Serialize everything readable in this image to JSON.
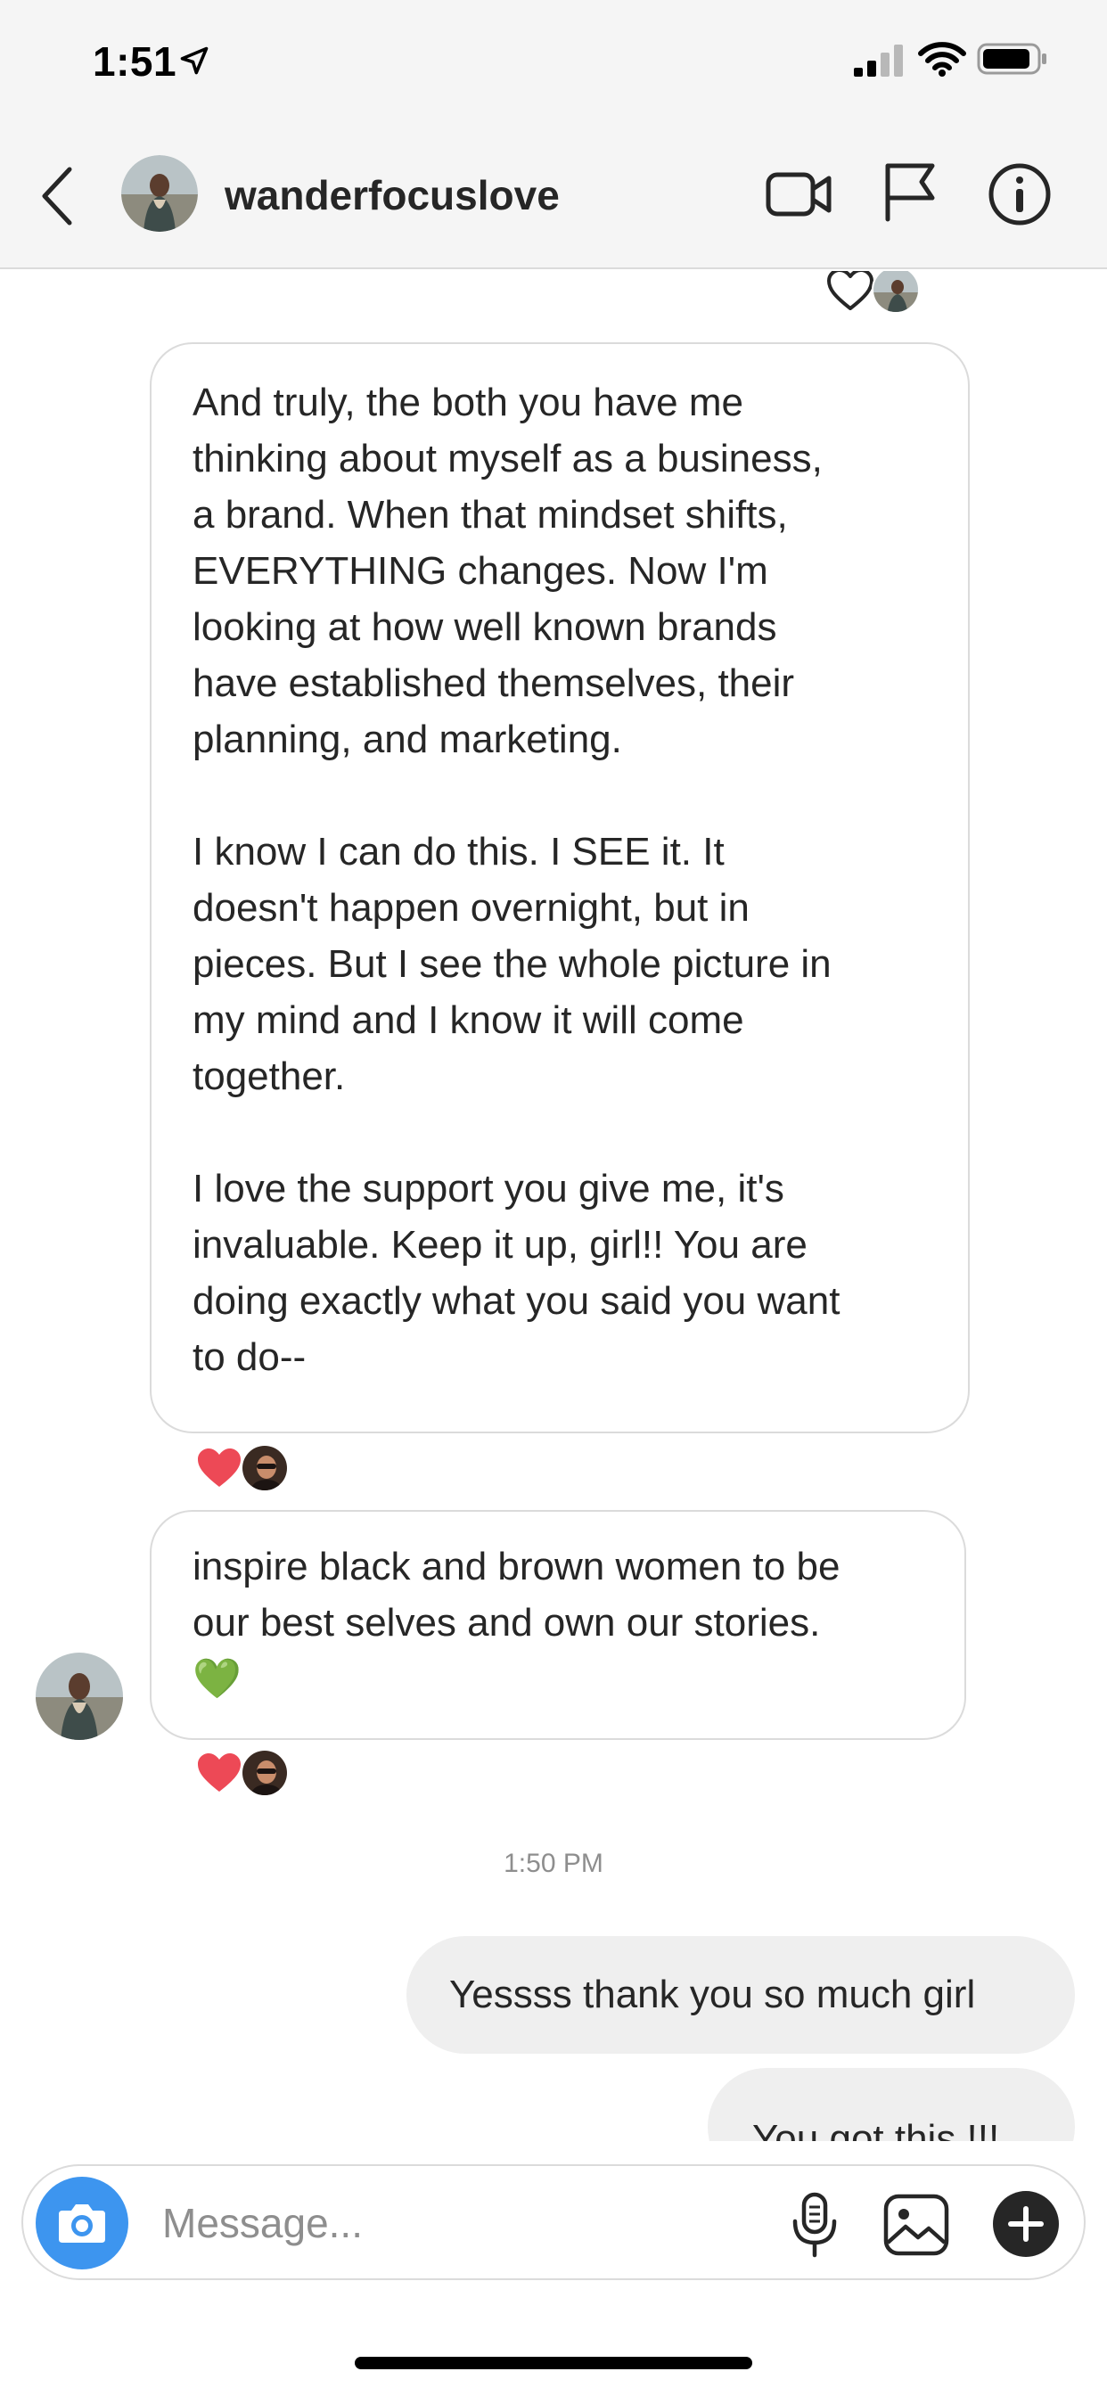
{
  "status_bar": {
    "time": "1:51"
  },
  "header": {
    "username": "wanderfocuslove"
  },
  "messages": {
    "bubble1": {
      "p1": "And truly, the both you have me\nthinking about myself as a business,\na brand. When that mindset shifts,\nEVERYTHING changes. Now I'm\nlooking at how well known brands\nhave established themselves, their\nplanning, and marketing.",
      "p2": "I know I can do this. I SEE it. It\ndoesn't happen overnight, but in\npieces. But I see the whole picture in\nmy mind and I know it will come\ntogether.",
      "p3": "I love the support you give me, it's\ninvaluable. Keep it up, girl!! You are\ndoing exactly what you said you want\nto do--"
    },
    "bubble2": {
      "text": "inspire black and brown women to be\nour best selves and own our stories.\n💚"
    },
    "timestamp": "1:50 PM",
    "sent": [
      "Yessss thank you so much girl",
      "You got this !!!"
    ]
  },
  "composer": {
    "placeholder": "Message..."
  },
  "colors": {
    "heart": "#ed4956",
    "camera_blue": "#3d95ef",
    "sent_bubble": "#efefef",
    "border": "#dbdbdb"
  },
  "icons": [
    "location-arrow-icon",
    "signal-icon",
    "wifi-icon",
    "battery-icon",
    "back-chevron-icon",
    "video-call-icon",
    "flag-icon",
    "info-icon",
    "heart-outline-icon",
    "heart-filled-icon",
    "camera-icon",
    "microphone-icon",
    "gallery-icon",
    "plus-icon"
  ]
}
